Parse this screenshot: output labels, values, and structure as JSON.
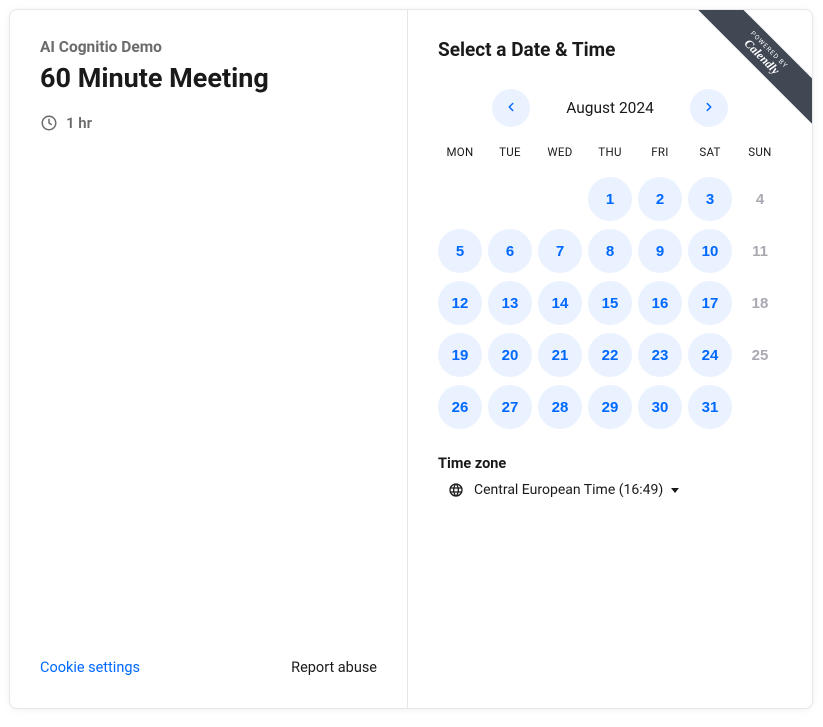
{
  "branding": {
    "powered_by": "POWERED BY",
    "brand": "Calendly"
  },
  "left": {
    "host": "AI Cognitio Demo",
    "title": "60 Minute Meeting",
    "duration": "1 hr",
    "cookie_settings": "Cookie settings",
    "report_abuse": "Report abuse"
  },
  "right": {
    "heading": "Select a Date & Time",
    "month_label": "August 2024",
    "dow": [
      "MON",
      "TUE",
      "WED",
      "THU",
      "FRI",
      "SAT",
      "SUN"
    ],
    "days": [
      {
        "n": "",
        "state": "empty"
      },
      {
        "n": "",
        "state": "empty"
      },
      {
        "n": "",
        "state": "empty"
      },
      {
        "n": "1",
        "state": "available"
      },
      {
        "n": "2",
        "state": "available"
      },
      {
        "n": "3",
        "state": "available"
      },
      {
        "n": "4",
        "state": "unavailable"
      },
      {
        "n": "5",
        "state": "available"
      },
      {
        "n": "6",
        "state": "available"
      },
      {
        "n": "7",
        "state": "available"
      },
      {
        "n": "8",
        "state": "available"
      },
      {
        "n": "9",
        "state": "available"
      },
      {
        "n": "10",
        "state": "available"
      },
      {
        "n": "11",
        "state": "unavailable"
      },
      {
        "n": "12",
        "state": "available"
      },
      {
        "n": "13",
        "state": "available"
      },
      {
        "n": "14",
        "state": "available"
      },
      {
        "n": "15",
        "state": "available"
      },
      {
        "n": "16",
        "state": "available"
      },
      {
        "n": "17",
        "state": "available"
      },
      {
        "n": "18",
        "state": "unavailable"
      },
      {
        "n": "19",
        "state": "available"
      },
      {
        "n": "20",
        "state": "available"
      },
      {
        "n": "21",
        "state": "available"
      },
      {
        "n": "22",
        "state": "available"
      },
      {
        "n": "23",
        "state": "available"
      },
      {
        "n": "24",
        "state": "available"
      },
      {
        "n": "25",
        "state": "unavailable"
      },
      {
        "n": "26",
        "state": "available"
      },
      {
        "n": "27",
        "state": "available"
      },
      {
        "n": "28",
        "state": "available"
      },
      {
        "n": "29",
        "state": "available"
      },
      {
        "n": "30",
        "state": "available"
      },
      {
        "n": "31",
        "state": "available"
      }
    ],
    "timezone": {
      "label": "Time zone",
      "value": "Central European Time (16:49)"
    }
  }
}
